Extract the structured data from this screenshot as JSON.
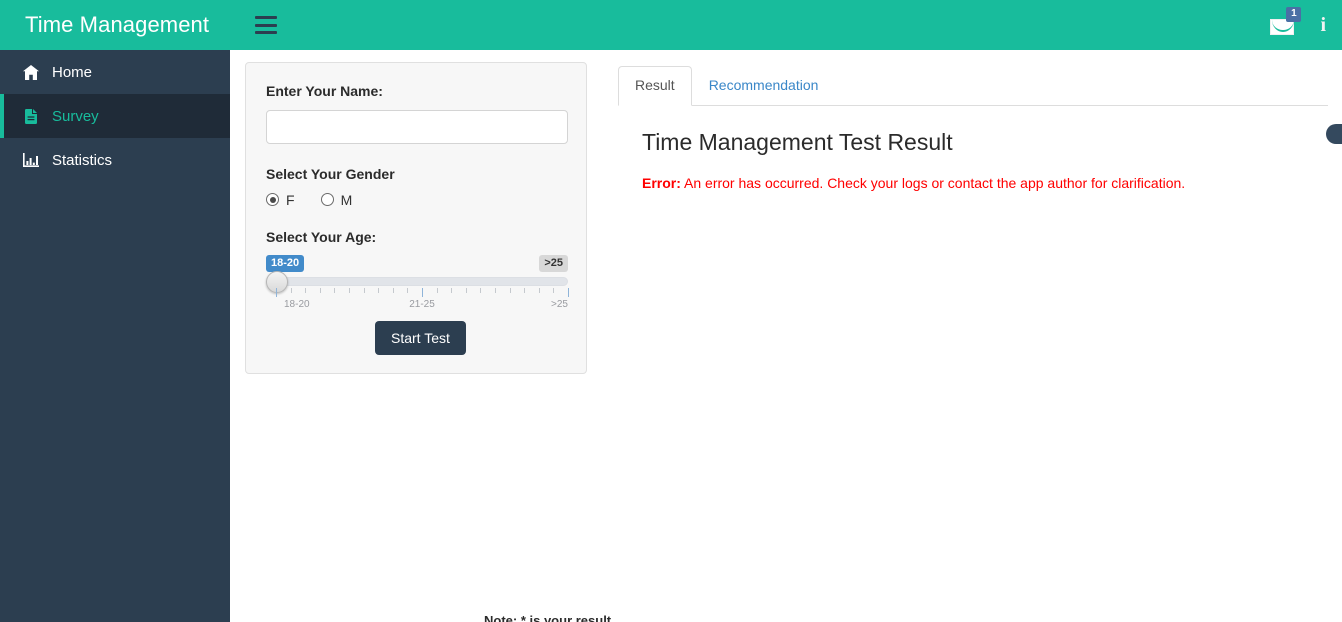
{
  "navbar": {
    "brand": "Time Management",
    "menu_toggle_icon": "hamburger-icon",
    "messages_badge": "1",
    "messages_icon": "envelope-icon",
    "info_icon": "i",
    "bg_color": "#18bc9c"
  },
  "sidebar": {
    "bg_color": "#2c3e50",
    "active_color": "#18bc9c",
    "items": [
      {
        "label": "Home",
        "icon": "home-icon",
        "active": false
      },
      {
        "label": "Survey",
        "icon": "file-icon",
        "active": true
      },
      {
        "label": "Statistics",
        "icon": "bar-chart-icon",
        "active": false
      }
    ]
  },
  "form": {
    "name_label": "Enter Your Name:",
    "name_value": "",
    "name_placeholder": "",
    "gender_label": "Select Your Gender",
    "gender_options": [
      {
        "label": "F",
        "checked": true
      },
      {
        "label": "M",
        "checked": false
      }
    ],
    "age_label": "Select Your Age:",
    "slider": {
      "from_tooltip": "18-20",
      "to_tooltip": ">25",
      "from_tooltip_color": "#428bca",
      "to_tooltip_color": "#d8d8d8",
      "grid_labels": [
        "18-20",
        "21-25",
        ">25"
      ],
      "handle_position_pct": 0,
      "value": "18-20"
    },
    "submit_label": "Start Test",
    "submit_color": "#2c3e50"
  },
  "result": {
    "tabs": [
      {
        "label": "Result",
        "active": true
      },
      {
        "label": "Recommendation",
        "active": false
      }
    ],
    "title": "Time Management Test Result",
    "error_prefix": "Error:",
    "error_message": " An error has occurred. Check your logs or contact the app author for clarification.",
    "error_color": "#ff0000",
    "toggle_pill": "",
    "note": "Note: * is your result"
  }
}
